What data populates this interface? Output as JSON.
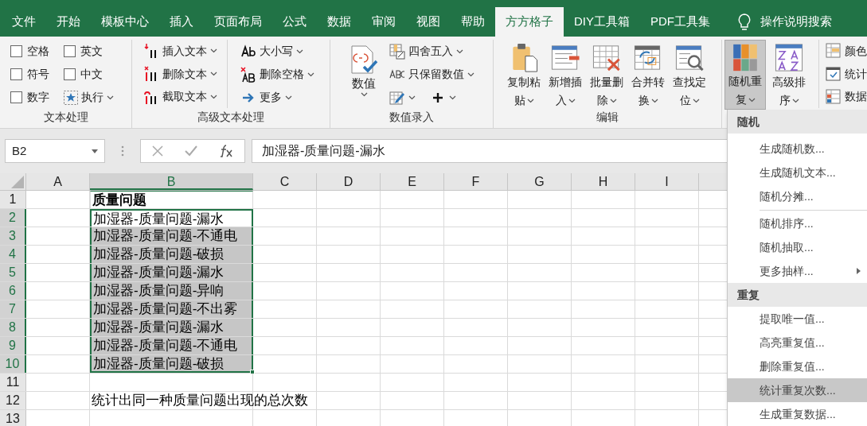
{
  "tabs": [
    {
      "label": "文件",
      "selected": false
    },
    {
      "label": "开始",
      "selected": false
    },
    {
      "label": "模板中心",
      "selected": false
    },
    {
      "label": "插入",
      "selected": false
    },
    {
      "label": "页面布局",
      "selected": false
    },
    {
      "label": "公式",
      "selected": false
    },
    {
      "label": "数据",
      "selected": false
    },
    {
      "label": "审阅",
      "selected": false
    },
    {
      "label": "视图",
      "selected": false
    },
    {
      "label": "帮助",
      "selected": false
    },
    {
      "label": "方方格子",
      "selected": true
    },
    {
      "label": "DIY工具箱",
      "selected": false
    },
    {
      "label": "PDF工具集",
      "selected": false
    }
  ],
  "tell_me": {
    "label": "操作说明搜索"
  },
  "ribbon": {
    "text_group": {
      "title": "文本处理",
      "checkboxes": [
        {
          "label": "空格",
          "checked": false
        },
        {
          "label": "符号",
          "checked": false
        },
        {
          "label": "数字",
          "checked": false
        },
        {
          "label": "英文",
          "checked": false
        },
        {
          "label": "中文",
          "checked": false
        }
      ],
      "execute": "执行"
    },
    "advanced_group": {
      "title": "高级文本处理",
      "items": [
        {
          "label": "插入文本"
        },
        {
          "label": "删除文本"
        },
        {
          "label": "截取文本"
        },
        {
          "label": "大小写"
        },
        {
          "label": "删除空格"
        },
        {
          "label": "更多"
        }
      ]
    },
    "number_group": {
      "title": "数值录入",
      "big": "数值",
      "items": [
        {
          "label": "四舍五入"
        },
        {
          "label": "只保留数值"
        }
      ]
    },
    "edit_group": {
      "title": "编辑",
      "buttons": [
        {
          "label": "复制粘贴",
          "pressed": false
        },
        {
          "label": "新增插入",
          "pressed": false
        },
        {
          "label": "批量删除",
          "pressed": false
        },
        {
          "label": "合并转换",
          "pressed": false
        },
        {
          "label": "查找定位",
          "pressed": false
        }
      ]
    },
    "random_group": {
      "buttons": [
        {
          "label": "随机重复",
          "pressed": true
        },
        {
          "label": "高级排序",
          "pressed": false
        }
      ],
      "items": [
        {
          "label": "颜色"
        },
        {
          "label": "统计"
        },
        {
          "label": "数据"
        }
      ]
    }
  },
  "formula_bar": {
    "name_box": "B2",
    "value": "加湿器-质量问题-漏水"
  },
  "sheet": {
    "columns": [
      {
        "label": "A",
        "selected": false
      },
      {
        "label": "B",
        "selected": true
      },
      {
        "label": "C",
        "selected": false
      },
      {
        "label": "D",
        "selected": false
      },
      {
        "label": "E",
        "selected": false
      },
      {
        "label": "F",
        "selected": false
      },
      {
        "label": "G",
        "selected": false
      },
      {
        "label": "H",
        "selected": false
      },
      {
        "label": "I",
        "selected": false
      }
    ],
    "rows": [
      {
        "number": "1",
        "selected": false,
        "cell_b": {
          "text": "质量问题",
          "bold": true,
          "selected": false
        }
      },
      {
        "number": "2",
        "selected": true,
        "cell_b": {
          "text": "加湿器-质量问题-漏水",
          "bold": false,
          "selected": true,
          "active": true
        }
      },
      {
        "number": "3",
        "selected": true,
        "cell_b": {
          "text": "加湿器-质量问题-不通电",
          "bold": false,
          "selected": true,
          "active": false
        }
      },
      {
        "number": "4",
        "selected": true,
        "cell_b": {
          "text": "加湿器-质量问题-破损",
          "bold": false,
          "selected": true,
          "active": false
        }
      },
      {
        "number": "5",
        "selected": true,
        "cell_b": {
          "text": "加湿器-质量问题-漏水",
          "bold": false,
          "selected": true,
          "active": false
        }
      },
      {
        "number": "6",
        "selected": true,
        "cell_b": {
          "text": "加湿器-质量问题-异响",
          "bold": false,
          "selected": true,
          "active": false
        }
      },
      {
        "number": "7",
        "selected": true,
        "cell_b": {
          "text": "加湿器-质量问题-不出雾",
          "bold": false,
          "selected": true,
          "active": false
        }
      },
      {
        "number": "8",
        "selected": true,
        "cell_b": {
          "text": "加湿器-质量问题-漏水",
          "bold": false,
          "selected": true,
          "active": false
        }
      },
      {
        "number": "9",
        "selected": true,
        "cell_b": {
          "text": "加湿器-质量问题-不通电",
          "bold": false,
          "selected": true,
          "active": false
        }
      },
      {
        "number": "10",
        "selected": true,
        "cell_b": {
          "text": "加湿器-质量问题-破损",
          "bold": false,
          "selected": true,
          "active": false
        }
      },
      {
        "number": "11",
        "selected": false
      },
      {
        "number": "12",
        "selected": false,
        "cell_b": {
          "text": "统计出同一种质量问题出现的总次数",
          "bold": false,
          "selected": false
        }
      },
      {
        "number": "13",
        "selected": false
      }
    ]
  },
  "dropdown_menu": [
    {
      "kind": "header",
      "label": "随机"
    },
    {
      "kind": "item",
      "label": "生成随机数...",
      "highlighted": false,
      "submenu": false
    },
    {
      "kind": "item",
      "label": "生成随机文本...",
      "highlighted": false,
      "submenu": false
    },
    {
      "kind": "item",
      "label": "随机分摊...",
      "highlighted": false,
      "submenu": false
    },
    {
      "kind": "separator"
    },
    {
      "kind": "item",
      "label": "随机排序...",
      "highlighted": false,
      "submenu": false
    },
    {
      "kind": "item",
      "label": "随机抽取...",
      "highlighted": false,
      "submenu": false
    },
    {
      "kind": "item",
      "label": "更多抽样...",
      "highlighted": false,
      "submenu": true
    },
    {
      "kind": "header",
      "label": "重复"
    },
    {
      "kind": "item",
      "label": "提取唯一值...",
      "highlighted": false,
      "submenu": false
    },
    {
      "kind": "item",
      "label": "高亮重复值...",
      "highlighted": false,
      "submenu": false
    },
    {
      "kind": "item",
      "label": "删除重复值...",
      "highlighted": false,
      "submenu": false
    },
    {
      "kind": "item",
      "label": "统计重复次数...",
      "highlighted": true,
      "submenu": false
    },
    {
      "kind": "item",
      "label": "生成重复数据...",
      "highlighted": false,
      "submenu": false
    }
  ]
}
